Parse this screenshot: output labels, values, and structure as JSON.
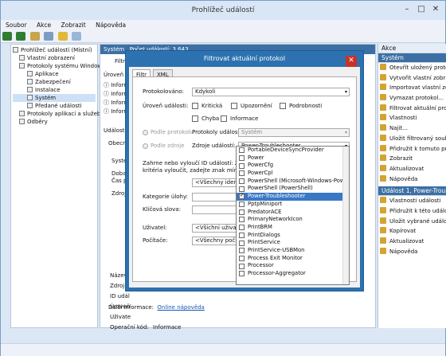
{
  "app": {
    "title": "Prohlížeč událostí"
  },
  "menu": [
    "Soubor",
    "Akce",
    "Zobrazit",
    "Nápověda"
  ],
  "tree": {
    "root": "Prohlížeč událostí (Místní)",
    "items": [
      "Vlastní zobrazení",
      "Protokoly systému Windows",
      "Aplikace",
      "Zabezpečení",
      "Instalace",
      "Systém",
      "Předané události",
      "Protokoly aplikací a služeb",
      "Odběry"
    ]
  },
  "center": {
    "header_name": "Systém",
    "header_count": "Počet událostí: 3 643",
    "filter_label": "Filtr",
    "col_level": "Úroveň",
    "info_rows": [
      "Informa",
      "Informa",
      "Informa",
      "Informa"
    ],
    "event_label": "Událost 1,",
    "general_tab": "Obecné",
    "detail_system": "System",
    "detail_doba": "Doba o",
    "detail_cas": "Čas pr",
    "detail_zdroj": "Zdroj p",
    "fields": [
      "Název p",
      "Zdroj:",
      "ID udál",
      "Úroveň",
      "Uživate"
    ],
    "opcode_label": "Operační kód:",
    "opcode_value": "Informace",
    "more_label": "Další informace:",
    "more_link": "Online nápověda"
  },
  "actions": {
    "section1": "Akce",
    "section2": "Systém",
    "items1": [
      "Otevřít uložený protokol",
      "Vytvořit vlastní zobrazení",
      "Importovat vlastní zobrazení",
      "Vymazat protokol...",
      "Filtrovat aktuální protokol",
      "Vlastnosti",
      "Najít...",
      "Uložit filtrovaný soubor",
      "Přidružit k tomuto protokolu",
      "Zobrazit",
      "Aktualizovat",
      "Nápověda"
    ],
    "section3": "Událost 1, Power-Troubleshooter",
    "items2": [
      "Vlastnosti události",
      "Přidružit k této události",
      "Uložit vybrané události",
      "Kopírovat",
      "Aktualizovat",
      "Nápověda"
    ]
  },
  "dialog": {
    "title": "Filtrovat aktuální protokol",
    "tab_filter": "Filtr",
    "tab_xml": "XML",
    "logged_label": "Protokolováno:",
    "logged_value": "Kdykoli",
    "level_label": "Úroveň události:",
    "levels": [
      "Kritická",
      "Upozornění",
      "Podrobnosti",
      "Chyba",
      "Informace"
    ],
    "by_log": "Podle protokolu",
    "logs_label": "Protokoly událostí:",
    "logs_value": "Systém",
    "by_source": "Podle zdroje",
    "sources_label": "Zdroje událostí:",
    "sources_value": "Power-Troubleshooter",
    "ids_text1": "Zahrne nebo vyloučí ID událostí: Zadejte čís",
    "ids_text2": "kritéria vyloučit, zadejte znak mínus. Příklad",
    "ids_value": "<Všechny identifikát",
    "category_label": "Kategorie úlohy:",
    "keywords_label": "Klíčová slova:",
    "user_label": "Uživatel:",
    "user_value": "<Všichni uživatelé>",
    "computer_label": "Počítače:",
    "computer_value": "<Všechny počítače>"
  },
  "dropdown": [
    "PortableDeviceSyncProvider",
    "Power",
    "PowerCfg",
    "PowerCpl",
    "PowerShell (Microsoft-Windows-PowerShell)",
    "PowerShell (PowerShell)",
    "Power-Troubleshooter",
    "PptpMiniport",
    "PredatorACE",
    "PrimaryNetworkIcon",
    "PrintBRM",
    "PrintDialogs",
    "PrintService",
    "PrintService-USBMon",
    "Process Exit Monitor",
    "Processor",
    "Processor-Aggregator"
  ],
  "dropdown_selected": "Power-Troubleshooter"
}
